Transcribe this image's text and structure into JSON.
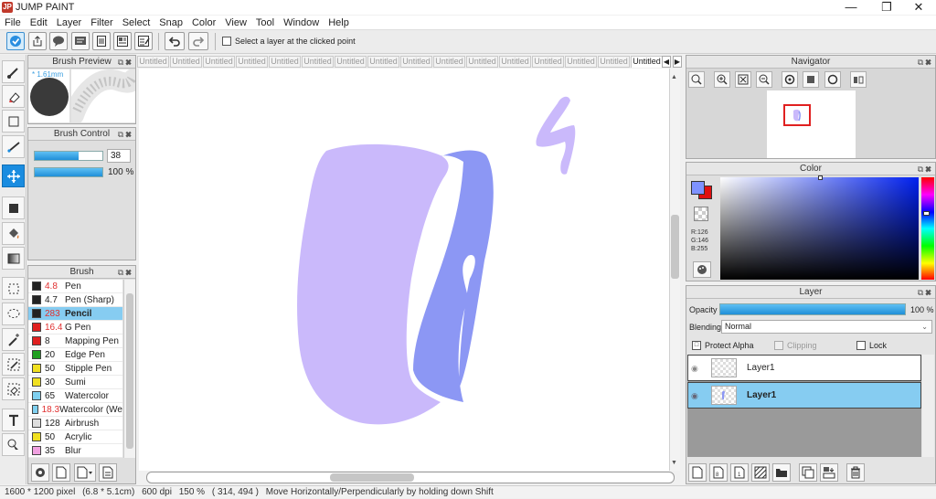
{
  "app": {
    "title": "JUMP PAINT"
  },
  "menu": [
    "File",
    "Edit",
    "Layer",
    "Filter",
    "Select",
    "Snap",
    "Color",
    "View",
    "Tool",
    "Window",
    "Help"
  ],
  "toolbar": {
    "select_layer_label": "Select a layer at the clicked point"
  },
  "brush_preview": {
    "title": "Brush Preview",
    "size_label": "* 1.61mm"
  },
  "brush_control": {
    "title": "Brush Control",
    "size_value": "38",
    "opacity_value": "100 %",
    "size_level": 0.65,
    "opacity_level": 1.0
  },
  "brush": {
    "title": "Brush",
    "items": [
      {
        "size": "4.8",
        "name": "Pen",
        "color": "#222222",
        "size_color": "#e03030",
        "selected": false
      },
      {
        "size": "4.7",
        "name": "Pen (Sharp)",
        "color": "#222222",
        "size_color": "#222222",
        "selected": false
      },
      {
        "size": "283",
        "name": "Pencil",
        "color": "#222222",
        "size_color": "#e03030",
        "selected": true
      },
      {
        "size": "16.4",
        "name": "G Pen",
        "color": "#e02020",
        "size_color": "#e03030",
        "selected": false
      },
      {
        "size": "8",
        "name": "Mapping Pen",
        "color": "#e02020",
        "size_color": "#222222",
        "selected": false
      },
      {
        "size": "20",
        "name": "Edge Pen",
        "color": "#22a022",
        "size_color": "#222222",
        "selected": false
      },
      {
        "size": "50",
        "name": "Stipple Pen",
        "color": "#f0e020",
        "size_color": "#222222",
        "selected": false
      },
      {
        "size": "30",
        "name": "Sumi",
        "color": "#f0e020",
        "size_color": "#222222",
        "selected": false
      },
      {
        "size": "65",
        "name": "Watercolor",
        "color": "#7fd0f0",
        "size_color": "#222222",
        "selected": false
      },
      {
        "size": "18.3",
        "name": "Watercolor (We",
        "color": "#7fd0f0",
        "size_color": "#e03030",
        "selected": false
      },
      {
        "size": "128",
        "name": "Airbrush",
        "color": "#dddddd",
        "size_color": "#222222",
        "selected": false
      },
      {
        "size": "50",
        "name": "Acrylic",
        "color": "#f0e020",
        "size_color": "#222222",
        "selected": false
      },
      {
        "size": "35",
        "name": "Blur",
        "color": "#f0a0e0",
        "size_color": "#222222",
        "selected": false
      }
    ]
  },
  "tabs": [
    "Untitled",
    "Untitled",
    "Untitled",
    "Untitled",
    "Untitled",
    "Untitled",
    "Untitled",
    "Untitled",
    "Untitled",
    "Untitled",
    "Untitled",
    "Untitled",
    "Untitled",
    "Untitled",
    "Untitled",
    "Untitled"
  ],
  "navigator": {
    "title": "Navigator"
  },
  "color": {
    "title": "Color",
    "r_label": "R:126",
    "g_label": "G:146",
    "b_label": "B:255",
    "main": "#7e92ff",
    "sub": "#e01010"
  },
  "layer": {
    "title": "Layer",
    "opacity_label": "Opacity",
    "opacity_value": "100 %",
    "opacity_level": 1.0,
    "blending_label": "Blending",
    "blending_value": "Normal",
    "protect_alpha": "Protect Alpha",
    "clipping": "Clipping",
    "lock": "Lock",
    "items": [
      {
        "name": "Layer1",
        "selected": false
      },
      {
        "name": "Layer1",
        "selected": true
      }
    ]
  },
  "status": {
    "size": "1600 * 1200 pixel",
    "cm": "(6.8 * 5.1cm)",
    "dpi": "600 dpi",
    "zoom": "150 %",
    "coords": "( 314, 494 )",
    "hint": "Move Horizontally/Perpendicularly by holding down Shift"
  },
  "drawing_colors": {
    "light": "#cab9fb",
    "dark": "#8c97f4"
  }
}
